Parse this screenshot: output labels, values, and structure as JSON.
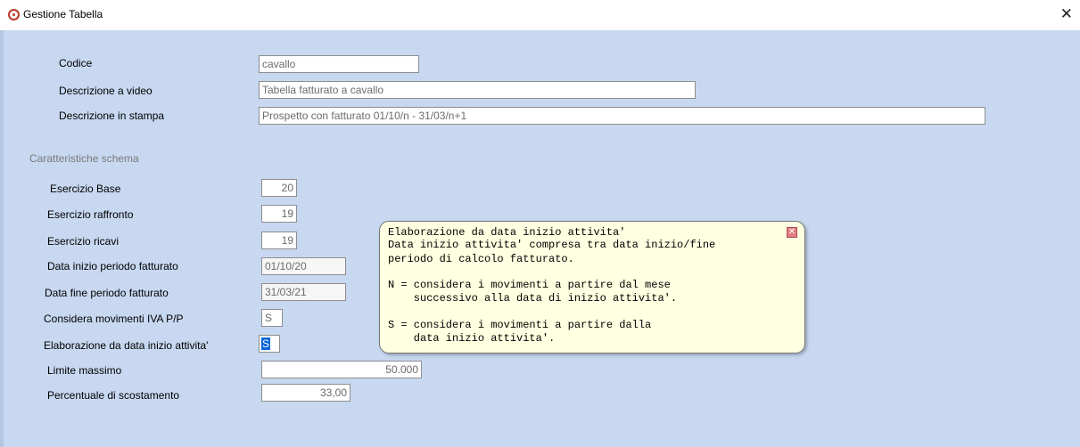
{
  "window": {
    "title": "Gestione Tabella",
    "close_glyph": "✕"
  },
  "fields": {
    "codice": {
      "label": "Codice",
      "value": "cavallo"
    },
    "descrizione_video": {
      "label": "Descrizione a video",
      "value": "Tabella fatturato a cavallo"
    },
    "descrizione_stampa": {
      "label": "Descrizione in stampa",
      "value": "Prospetto con fatturato 01/10/n - 31/03/n+1"
    }
  },
  "section_title": "Caratteristiche schema",
  "schema": {
    "esercizio_base": {
      "label": "Esercizio Base",
      "value": "20"
    },
    "esercizio_raffronto": {
      "label": "Esercizio raffronto",
      "value": "19"
    },
    "esercizio_ricavi": {
      "label": "Esercizio ricavi",
      "value": "19"
    },
    "data_inizio": {
      "label": "Data inizio periodo fatturato",
      "value": "01/10/20"
    },
    "data_fine": {
      "label": "Data fine  periodo fatturato",
      "value": "31/03/21"
    },
    "considera_iva": {
      "label": "Considera movimenti IVA P/P",
      "value": "S"
    },
    "elaborazione": {
      "label": "Elaborazione da data inizio attivita'",
      "value": "S"
    },
    "limite_massimo": {
      "label": "Limite massimo",
      "value": "50.000"
    },
    "percentuale": {
      "label": "Percentuale di scostamento",
      "value": "33,00"
    }
  },
  "tooltip": {
    "lines": [
      "Elaborazione da data inizio attivita'",
      "Data inizio attivita' compresa tra data inizio/fine",
      "periodo di calcolo fatturato.",
      "N = considera i movimenti a partire dal mese",
      "    successivo alla data di inizio attivita'.",
      "S = considera i movimenti a partire dalla",
      "    data inizio attivita'."
    ],
    "close_glyph": "✕"
  },
  "colors": {
    "background": "#c7d8f0",
    "tooltip_bg": "#ffffe1",
    "selection": "#0a64d6"
  }
}
